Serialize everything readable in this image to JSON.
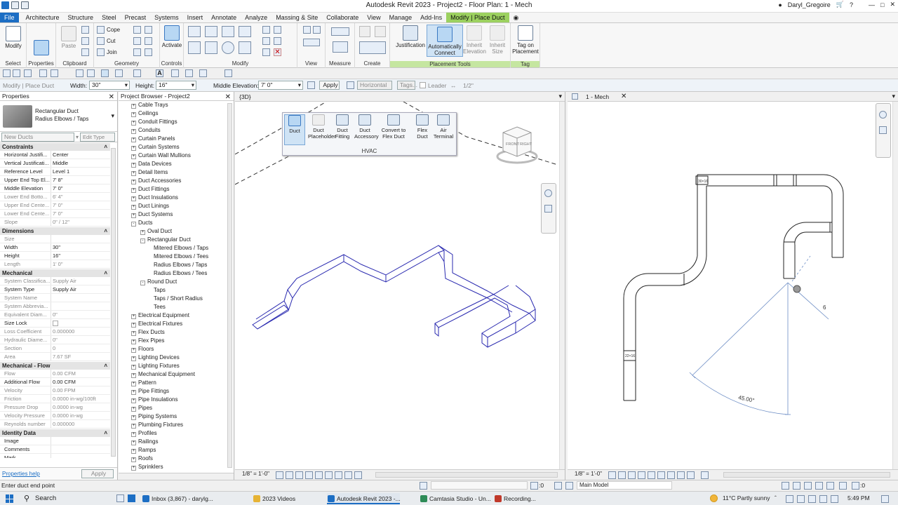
{
  "window": {
    "title": "Autodesk Revit 2023 - Project2 - Floor Plan: 1 - Mech",
    "user": "Daryl_Gregoire"
  },
  "menu": {
    "tabs": [
      "File",
      "Architecture",
      "Structure",
      "Steel",
      "Precast",
      "Systems",
      "Insert",
      "Annotate",
      "Analyze",
      "Massing & Site",
      "Collaborate",
      "View",
      "Manage",
      "Add-Ins",
      "Modify | Place Duct"
    ]
  },
  "ribbon": {
    "modify": "Modify",
    "properties": "Properties",
    "paste": "Paste",
    "cope": "Cope",
    "cut": "Cut",
    "join": "Join",
    "activate": "Activate",
    "justification": "Justification",
    "auto_connect": "Automatically Connect",
    "inherit_elevation": "Inherit Elevation",
    "inherit_size": "Inherit Size",
    "tag_on_placement": "Tag on Placement",
    "panels": {
      "select": "Select",
      "properties": "Properties",
      "clipboard": "Clipboard",
      "geometry": "Geometry",
      "controls": "Controls",
      "modify": "Modify",
      "view": "View",
      "measure": "Measure",
      "create": "Create",
      "placement_tools": "Placement Tools",
      "tag": "Tag"
    }
  },
  "options": {
    "context": "Modify | Place Duct",
    "width_label": "Width:",
    "width_value": "30\"",
    "height_label": "Height:",
    "height_value": "16\"",
    "middle_elev_label": "Middle Elevation:",
    "middle_elev_value": "7' 0\"",
    "apply": "Apply",
    "horizontal": "Horizontal",
    "tags": "Tags...",
    "leader": "Leader",
    "leader_len": "1/2\""
  },
  "properties": {
    "title": "Properties",
    "type_line1": "Rectangular Duct",
    "type_line2": "Radius Elbows / Taps",
    "instance": "New Ducts",
    "edit_type": "Edit Type",
    "help": "Properties help",
    "apply": "Apply",
    "sections": [
      {
        "name": "Constraints",
        "rows": [
          [
            "Horizontal Justifi...",
            "Center",
            false
          ],
          [
            "Vertical Justificati...",
            "Middle",
            false
          ],
          [
            "Reference Level",
            "Level 1",
            false
          ],
          [
            "Upper End Top El...",
            "7' 8\"",
            false
          ],
          [
            "Middle Elevation",
            "7' 0\"",
            false
          ],
          [
            "Lower End Botto...",
            "6' 4\"",
            true
          ],
          [
            "Upper End Cente...",
            "7' 0\"",
            true
          ],
          [
            "Lower End Cente...",
            "7' 0\"",
            true
          ],
          [
            "Slope",
            "0\" / 12\"",
            true
          ]
        ]
      },
      {
        "name": "Dimensions",
        "rows": [
          [
            "Size",
            "",
            true
          ],
          [
            "Width",
            "30\"",
            false
          ],
          [
            "Height",
            "16\"",
            false
          ],
          [
            "Length",
            "1' 0\"",
            true
          ]
        ]
      },
      {
        "name": "Mechanical",
        "rows": [
          [
            "System Classifica...",
            "Supply Air",
            true
          ],
          [
            "System Type",
            "Supply Air",
            false
          ],
          [
            "System Name",
            "",
            true
          ],
          [
            "System Abbrevia...",
            "",
            true
          ],
          [
            "Equivalent Diam...",
            "0\"",
            true
          ],
          [
            "Size Lock",
            "",
            false
          ],
          [
            "Loss Coefficient",
            "0.000000",
            true
          ],
          [
            "Hydraulic Diame...",
            "0\"",
            true
          ],
          [
            "Section",
            "0",
            true
          ],
          [
            "Area",
            "7.67 SF",
            true
          ]
        ]
      },
      {
        "name": "Mechanical - Flow",
        "rows": [
          [
            "Flow",
            "0.00 CFM",
            true
          ],
          [
            "Additional Flow",
            "0.00 CFM",
            false
          ],
          [
            "Velocity",
            "0.00 FPM",
            true
          ],
          [
            "Friction",
            "0.0000 in-wg/100ft",
            true
          ],
          [
            "Pressure Drop",
            "0.0000 in-wg",
            true
          ],
          [
            "Velocity Pressure",
            "0.0000 in-wg",
            true
          ],
          [
            "Reynolds number",
            "0.000000",
            true
          ]
        ]
      },
      {
        "name": "Identity Data",
        "rows": [
          [
            "Image",
            "",
            false
          ],
          [
            "Comments",
            "",
            false
          ],
          [
            "Mark",
            "",
            false
          ]
        ]
      }
    ]
  },
  "browser": {
    "title": "Project Browser - Project2",
    "items": [
      {
        "label": "Cable Trays",
        "level": 0,
        "exp": "+"
      },
      {
        "label": "Ceilings",
        "level": 0,
        "exp": "+"
      },
      {
        "label": "Conduit Fittings",
        "level": 0,
        "exp": "+"
      },
      {
        "label": "Conduits",
        "level": 0,
        "exp": "+"
      },
      {
        "label": "Curtain Panels",
        "level": 0,
        "exp": "+"
      },
      {
        "label": "Curtain Systems",
        "level": 0,
        "exp": "+"
      },
      {
        "label": "Curtain Wall Mullions",
        "level": 0,
        "exp": "+"
      },
      {
        "label": "Data Devices",
        "level": 0,
        "exp": "+"
      },
      {
        "label": "Detail Items",
        "level": 0,
        "exp": "+"
      },
      {
        "label": "Duct Accessories",
        "level": 0,
        "exp": "+"
      },
      {
        "label": "Duct Fittings",
        "level": 0,
        "exp": "+"
      },
      {
        "label": "Duct Insulations",
        "level": 0,
        "exp": "+"
      },
      {
        "label": "Duct Linings",
        "level": 0,
        "exp": "+"
      },
      {
        "label": "Duct Systems",
        "level": 0,
        "exp": "+"
      },
      {
        "label": "Ducts",
        "level": 0,
        "exp": "-"
      },
      {
        "label": "Oval Duct",
        "level": 1,
        "exp": "+"
      },
      {
        "label": "Rectangular Duct",
        "level": 1,
        "exp": "-"
      },
      {
        "label": "Mitered Elbows / Taps",
        "level": 2,
        "exp": ""
      },
      {
        "label": "Mitered Elbows / Tees",
        "level": 2,
        "exp": ""
      },
      {
        "label": "Radius Elbows / Taps",
        "level": 2,
        "exp": ""
      },
      {
        "label": "Radius Elbows / Tees",
        "level": 2,
        "exp": ""
      },
      {
        "label": "Round Duct",
        "level": 1,
        "exp": "-"
      },
      {
        "label": "Taps",
        "level": 2,
        "exp": ""
      },
      {
        "label": "Taps / Short Radius",
        "level": 2,
        "exp": ""
      },
      {
        "label": "Tees",
        "level": 2,
        "exp": ""
      },
      {
        "label": "Electrical Equipment",
        "level": 0,
        "exp": "+"
      },
      {
        "label": "Electrical Fixtures",
        "level": 0,
        "exp": "+"
      },
      {
        "label": "Flex Ducts",
        "level": 0,
        "exp": "+"
      },
      {
        "label": "Flex Pipes",
        "level": 0,
        "exp": "+"
      },
      {
        "label": "Floors",
        "level": 0,
        "exp": "+"
      },
      {
        "label": "Lighting Devices",
        "level": 0,
        "exp": "+"
      },
      {
        "label": "Lighting Fixtures",
        "level": 0,
        "exp": "+"
      },
      {
        "label": "Mechanical Equipment",
        "level": 0,
        "exp": "+"
      },
      {
        "label": "Pattern",
        "level": 0,
        "exp": "+"
      },
      {
        "label": "Pipe Fittings",
        "level": 0,
        "exp": "+"
      },
      {
        "label": "Pipe Insulations",
        "level": 0,
        "exp": "+"
      },
      {
        "label": "Pipes",
        "level": 0,
        "exp": "+"
      },
      {
        "label": "Piping Systems",
        "level": 0,
        "exp": "+"
      },
      {
        "label": "Plumbing Fixtures",
        "level": 0,
        "exp": "+"
      },
      {
        "label": "Profiles",
        "level": 0,
        "exp": "+"
      },
      {
        "label": "Railings",
        "level": 0,
        "exp": "+"
      },
      {
        "label": "Ramps",
        "level": 0,
        "exp": "+"
      },
      {
        "label": "Roofs",
        "level": 0,
        "exp": "+"
      },
      {
        "label": "Sprinklers",
        "level": 0,
        "exp": "+"
      }
    ]
  },
  "view3d": {
    "tab": "{3D}",
    "scale": "1/8\" = 1'-0\"",
    "hvac": {
      "title": "HVAC",
      "buttons": [
        "Duct",
        "Duct Placeholder",
        "Duct Fitting",
        "Duct Accessory",
        "Convert to Flex Duct",
        "Flex Duct",
        "Air Terminal"
      ]
    },
    "cube": {
      "front": "FRONT",
      "right": "RIGHT"
    }
  },
  "viewplan": {
    "tab": "1 - Mech",
    "scale": "1/8\" = 1'-0\"",
    "angle": "45.00°",
    "dim": "6",
    "tag1": "30×16",
    "tag2": "22×16"
  },
  "status": {
    "prompt": "Enter duct end point",
    "zero": ":0",
    "model": "Main Model",
    "right_zero": ":0"
  },
  "taskbar": {
    "search": "Search",
    "apps": [
      "Inbox (3,867) - darylg...",
      "2023 Videos",
      "Autodesk Revit 2023 -...",
      "Camtasia Studio - Un...",
      "Recording..."
    ],
    "weather": "11°C  Partly sunny",
    "time": "5:49 PM"
  },
  "colors": {
    "accent": "#1c6ec4",
    "context_tab": "#9cd15f",
    "duct_line": "#2a2ab0"
  }
}
